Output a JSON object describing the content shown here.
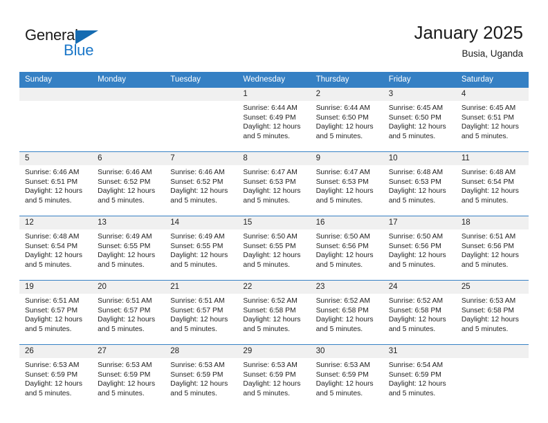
{
  "brand": {
    "name_part1": "General",
    "name_part2": "Blue",
    "triangle_color": "#156bb1",
    "blue_color": "#1976c8"
  },
  "header": {
    "title": "January 2025",
    "subtitle": "Busia, Uganda"
  },
  "theme": {
    "header_bar": "#3580c4",
    "daynum_band": "#f0f0f0",
    "row_rule": "#3580c4",
    "text": "#222222"
  },
  "weekday_headers": [
    "Sunday",
    "Monday",
    "Tuesday",
    "Wednesday",
    "Thursday",
    "Friday",
    "Saturday"
  ],
  "labels": {
    "sunrise_prefix": "Sunrise: ",
    "sunset_prefix": "Sunset: ",
    "daylight_prefix": "Daylight: "
  },
  "weeks": [
    [
      {
        "day": "",
        "empty": true
      },
      {
        "day": "",
        "empty": true
      },
      {
        "day": "",
        "empty": true
      },
      {
        "day": "1",
        "sunrise": "Sunrise: 6:44 AM",
        "sunset": "Sunset: 6:49 PM",
        "daylight_line1": "Daylight: 12 hours",
        "daylight_line2": "and 5 minutes."
      },
      {
        "day": "2",
        "sunrise": "Sunrise: 6:44 AM",
        "sunset": "Sunset: 6:50 PM",
        "daylight_line1": "Daylight: 12 hours",
        "daylight_line2": "and 5 minutes."
      },
      {
        "day": "3",
        "sunrise": "Sunrise: 6:45 AM",
        "sunset": "Sunset: 6:50 PM",
        "daylight_line1": "Daylight: 12 hours",
        "daylight_line2": "and 5 minutes."
      },
      {
        "day": "4",
        "sunrise": "Sunrise: 6:45 AM",
        "sunset": "Sunset: 6:51 PM",
        "daylight_line1": "Daylight: 12 hours",
        "daylight_line2": "and 5 minutes."
      }
    ],
    [
      {
        "day": "5",
        "sunrise": "Sunrise: 6:46 AM",
        "sunset": "Sunset: 6:51 PM",
        "daylight_line1": "Daylight: 12 hours",
        "daylight_line2": "and 5 minutes."
      },
      {
        "day": "6",
        "sunrise": "Sunrise: 6:46 AM",
        "sunset": "Sunset: 6:52 PM",
        "daylight_line1": "Daylight: 12 hours",
        "daylight_line2": "and 5 minutes."
      },
      {
        "day": "7",
        "sunrise": "Sunrise: 6:46 AM",
        "sunset": "Sunset: 6:52 PM",
        "daylight_line1": "Daylight: 12 hours",
        "daylight_line2": "and 5 minutes."
      },
      {
        "day": "8",
        "sunrise": "Sunrise: 6:47 AM",
        "sunset": "Sunset: 6:53 PM",
        "daylight_line1": "Daylight: 12 hours",
        "daylight_line2": "and 5 minutes."
      },
      {
        "day": "9",
        "sunrise": "Sunrise: 6:47 AM",
        "sunset": "Sunset: 6:53 PM",
        "daylight_line1": "Daylight: 12 hours",
        "daylight_line2": "and 5 minutes."
      },
      {
        "day": "10",
        "sunrise": "Sunrise: 6:48 AM",
        "sunset": "Sunset: 6:53 PM",
        "daylight_line1": "Daylight: 12 hours",
        "daylight_line2": "and 5 minutes."
      },
      {
        "day": "11",
        "sunrise": "Sunrise: 6:48 AM",
        "sunset": "Sunset: 6:54 PM",
        "daylight_line1": "Daylight: 12 hours",
        "daylight_line2": "and 5 minutes."
      }
    ],
    [
      {
        "day": "12",
        "sunrise": "Sunrise: 6:48 AM",
        "sunset": "Sunset: 6:54 PM",
        "daylight_line1": "Daylight: 12 hours",
        "daylight_line2": "and 5 minutes."
      },
      {
        "day": "13",
        "sunrise": "Sunrise: 6:49 AM",
        "sunset": "Sunset: 6:55 PM",
        "daylight_line1": "Daylight: 12 hours",
        "daylight_line2": "and 5 minutes."
      },
      {
        "day": "14",
        "sunrise": "Sunrise: 6:49 AM",
        "sunset": "Sunset: 6:55 PM",
        "daylight_line1": "Daylight: 12 hours",
        "daylight_line2": "and 5 minutes."
      },
      {
        "day": "15",
        "sunrise": "Sunrise: 6:50 AM",
        "sunset": "Sunset: 6:55 PM",
        "daylight_line1": "Daylight: 12 hours",
        "daylight_line2": "and 5 minutes."
      },
      {
        "day": "16",
        "sunrise": "Sunrise: 6:50 AM",
        "sunset": "Sunset: 6:56 PM",
        "daylight_line1": "Daylight: 12 hours",
        "daylight_line2": "and 5 minutes."
      },
      {
        "day": "17",
        "sunrise": "Sunrise: 6:50 AM",
        "sunset": "Sunset: 6:56 PM",
        "daylight_line1": "Daylight: 12 hours",
        "daylight_line2": "and 5 minutes."
      },
      {
        "day": "18",
        "sunrise": "Sunrise: 6:51 AM",
        "sunset": "Sunset: 6:56 PM",
        "daylight_line1": "Daylight: 12 hours",
        "daylight_line2": "and 5 minutes."
      }
    ],
    [
      {
        "day": "19",
        "sunrise": "Sunrise: 6:51 AM",
        "sunset": "Sunset: 6:57 PM",
        "daylight_line1": "Daylight: 12 hours",
        "daylight_line2": "and 5 minutes."
      },
      {
        "day": "20",
        "sunrise": "Sunrise: 6:51 AM",
        "sunset": "Sunset: 6:57 PM",
        "daylight_line1": "Daylight: 12 hours",
        "daylight_line2": "and 5 minutes."
      },
      {
        "day": "21",
        "sunrise": "Sunrise: 6:51 AM",
        "sunset": "Sunset: 6:57 PM",
        "daylight_line1": "Daylight: 12 hours",
        "daylight_line2": "and 5 minutes."
      },
      {
        "day": "22",
        "sunrise": "Sunrise: 6:52 AM",
        "sunset": "Sunset: 6:58 PM",
        "daylight_line1": "Daylight: 12 hours",
        "daylight_line2": "and 5 minutes."
      },
      {
        "day": "23",
        "sunrise": "Sunrise: 6:52 AM",
        "sunset": "Sunset: 6:58 PM",
        "daylight_line1": "Daylight: 12 hours",
        "daylight_line2": "and 5 minutes."
      },
      {
        "day": "24",
        "sunrise": "Sunrise: 6:52 AM",
        "sunset": "Sunset: 6:58 PM",
        "daylight_line1": "Daylight: 12 hours",
        "daylight_line2": "and 5 minutes."
      },
      {
        "day": "25",
        "sunrise": "Sunrise: 6:53 AM",
        "sunset": "Sunset: 6:58 PM",
        "daylight_line1": "Daylight: 12 hours",
        "daylight_line2": "and 5 minutes."
      }
    ],
    [
      {
        "day": "26",
        "sunrise": "Sunrise: 6:53 AM",
        "sunset": "Sunset: 6:59 PM",
        "daylight_line1": "Daylight: 12 hours",
        "daylight_line2": "and 5 minutes."
      },
      {
        "day": "27",
        "sunrise": "Sunrise: 6:53 AM",
        "sunset": "Sunset: 6:59 PM",
        "daylight_line1": "Daylight: 12 hours",
        "daylight_line2": "and 5 minutes."
      },
      {
        "day": "28",
        "sunrise": "Sunrise: 6:53 AM",
        "sunset": "Sunset: 6:59 PM",
        "daylight_line1": "Daylight: 12 hours",
        "daylight_line2": "and 5 minutes."
      },
      {
        "day": "29",
        "sunrise": "Sunrise: 6:53 AM",
        "sunset": "Sunset: 6:59 PM",
        "daylight_line1": "Daylight: 12 hours",
        "daylight_line2": "and 5 minutes."
      },
      {
        "day": "30",
        "sunrise": "Sunrise: 6:53 AM",
        "sunset": "Sunset: 6:59 PM",
        "daylight_line1": "Daylight: 12 hours",
        "daylight_line2": "and 5 minutes."
      },
      {
        "day": "31",
        "sunrise": "Sunrise: 6:54 AM",
        "sunset": "Sunset: 6:59 PM",
        "daylight_line1": "Daylight: 12 hours",
        "daylight_line2": "and 5 minutes."
      },
      {
        "day": "",
        "empty": true
      }
    ]
  ]
}
